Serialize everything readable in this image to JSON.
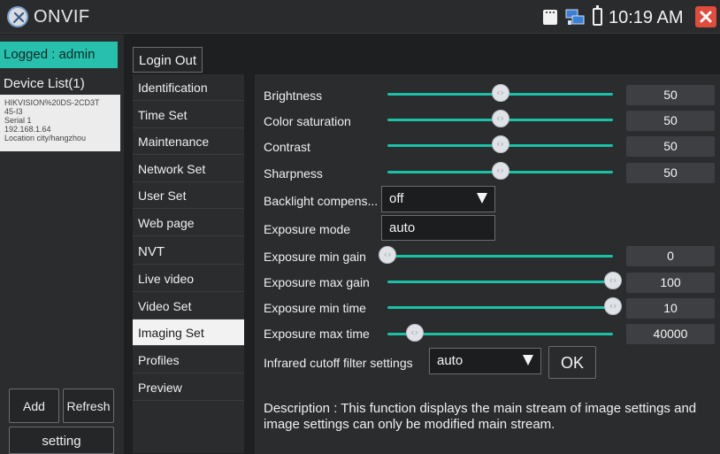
{
  "titlebar": {
    "app_title": "ONVIF",
    "clock": "10:19 AM"
  },
  "left": {
    "logged": "Logged : admin",
    "device_list_title": "Device List(1)",
    "device": {
      "name": "HIKVISION%20DS-2CD3T",
      "model": "45-I3",
      "serial": "Serial 1",
      "ip": "192.168.1.64",
      "location": "Location city/hangzhou"
    },
    "add_label": "Add",
    "refresh_label": "Refresh",
    "setting_label": "setting"
  },
  "middle": {
    "login_out": "Login Out",
    "menu": [
      {
        "label": "Identification",
        "selected": false
      },
      {
        "label": "Time Set",
        "selected": false
      },
      {
        "label": "Maintenance",
        "selected": false
      },
      {
        "label": "Network Set",
        "selected": false
      },
      {
        "label": "User Set",
        "selected": false
      },
      {
        "label": "Web page",
        "selected": false
      },
      {
        "label": "NVT",
        "selected": false
      },
      {
        "label": "Live video",
        "selected": false
      },
      {
        "label": "Video Set",
        "selected": false
      },
      {
        "label": "Imaging Set",
        "selected": true
      },
      {
        "label": "Profiles",
        "selected": false
      },
      {
        "label": "Preview",
        "selected": false
      }
    ]
  },
  "imaging": {
    "brightness": {
      "label": "Brightness",
      "value": "50",
      "fraction": 0.5
    },
    "color_saturation": {
      "label": "Color saturation",
      "value": "50",
      "fraction": 0.5
    },
    "contrast": {
      "label": "Contrast",
      "value": "50",
      "fraction": 0.5
    },
    "sharpness": {
      "label": "Sharpness",
      "value": "50",
      "fraction": 0.5
    },
    "backlight": {
      "label": "Backlight compens...",
      "value": "off"
    },
    "exposure_mode": {
      "label": "Exposure mode",
      "value": "auto"
    },
    "exposure_min_gain": {
      "label": "Exposure min gain",
      "value": "0",
      "fraction": 0.0
    },
    "exposure_max_gain": {
      "label": "Exposure max gain",
      "value": "100",
      "fraction": 1.0
    },
    "exposure_min_time": {
      "label": "Exposure min time",
      "value": "10",
      "fraction": 1.0
    },
    "exposure_max_time": {
      "label": "Exposure max time",
      "value": "40000",
      "fraction": 0.12
    },
    "ir_cutoff": {
      "label": "Infrared cutoff filter settings",
      "value": "auto"
    },
    "ok_label": "OK",
    "description": "Description : This function displays the main stream of image settings and image settings can only be modified main stream."
  },
  "colors": {
    "accent": "#27c0ad",
    "slider": "#1bc1a6",
    "close": "#e04b3b"
  },
  "icons": [
    "settings-logo-icon",
    "sd-card-icon",
    "network-icon",
    "battery-icon",
    "close-icon",
    "dropdown-arrow-icon",
    "slider-thumb-icon"
  ]
}
